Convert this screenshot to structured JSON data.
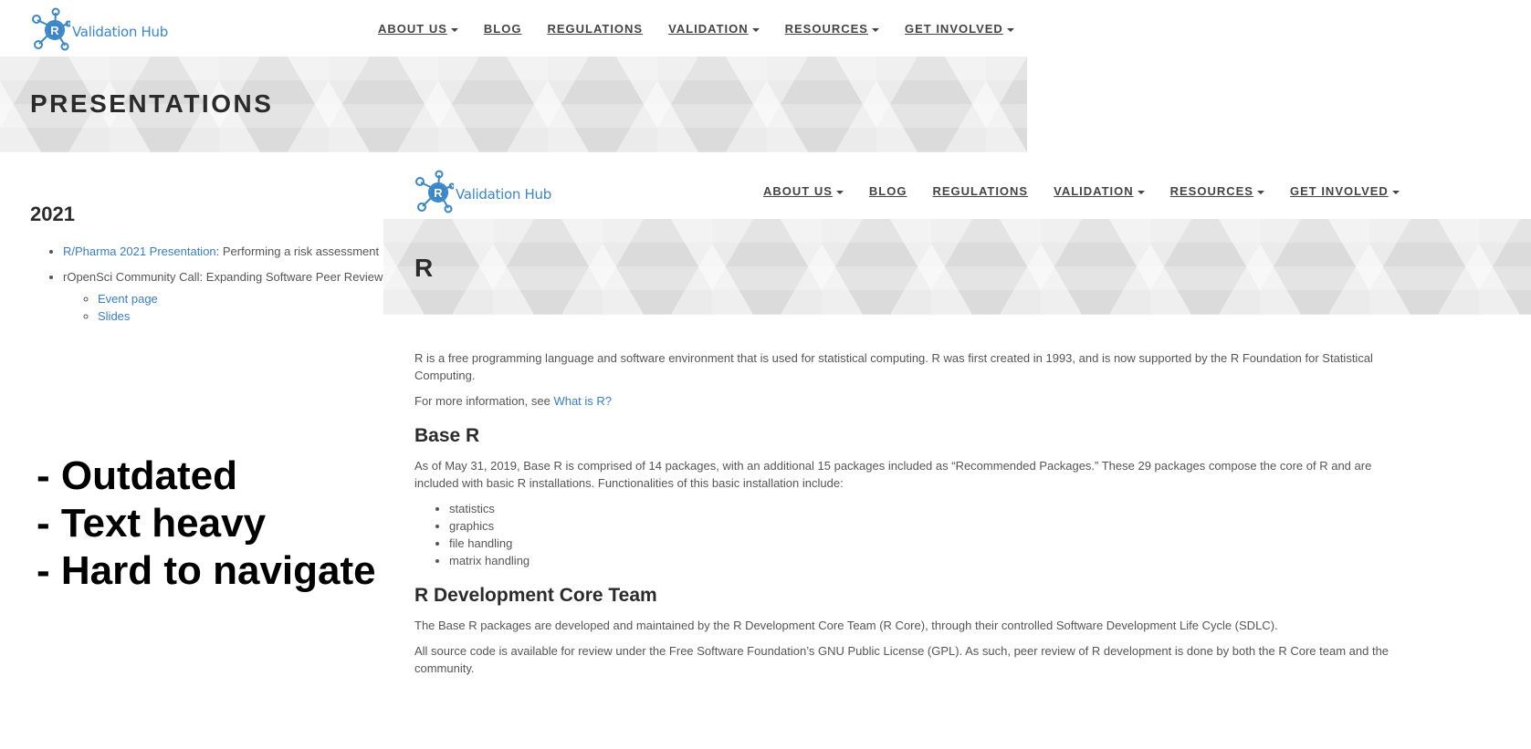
{
  "brand": {
    "logo_text": "Validation Hub",
    "logo_letter": "R",
    "accent": "#3a86c8"
  },
  "nav": [
    {
      "label": "ABOUT US",
      "has_dropdown": true
    },
    {
      "label": "BLOG",
      "has_dropdown": false
    },
    {
      "label": "REGULATIONS",
      "has_dropdown": false
    },
    {
      "label": "VALIDATION",
      "has_dropdown": true
    },
    {
      "label": "RESOURCES",
      "has_dropdown": true
    },
    {
      "label": "GET INVOLVED",
      "has_dropdown": true
    }
  ],
  "presentations_page": {
    "title": "PRESENTATIONS",
    "year": "2021",
    "item1_link": "R/Pharma 2021 Presentation",
    "item1_rest": ": Performing a risk assessment",
    "item2_text": "rOpenSci Community Call: Expanding Software Peer Review:",
    "sub_links": [
      "Event page",
      "Slides"
    ]
  },
  "r_page": {
    "title": "R",
    "intro": "R is a free programming language and software environment that is used for statistical computing. R was first created in 1993, and is now supported by the R Foundation for Statistical Computing.",
    "more_info_prefix": "For more information, see ",
    "more_info_link": "What is R?",
    "base_heading": "Base R",
    "base_text": "As of May 31, 2019, Base R is comprised of 14 packages, with an additional 15 packages included as “Recommended Packages.” These 29 packages compose the core of R and are included with basic R installations. Functionalities of this basic installation include:",
    "features": [
      "statistics",
      "graphics",
      "file handling",
      "matrix handling"
    ],
    "core_heading": "R Development Core Team",
    "core_text1": "The Base R packages are developed and maintained by the R Development Core Team (R Core), through their controlled Software Development Life Cycle (SDLC).",
    "core_text2": "All source code is available for review under the Free Software Foundation’s GNU Public License (GPL). As such, peer review of R development is done by both the R Core team and the community."
  },
  "notes": [
    "- Outdated",
    "- Text heavy",
    "- Hard to navigate"
  ]
}
